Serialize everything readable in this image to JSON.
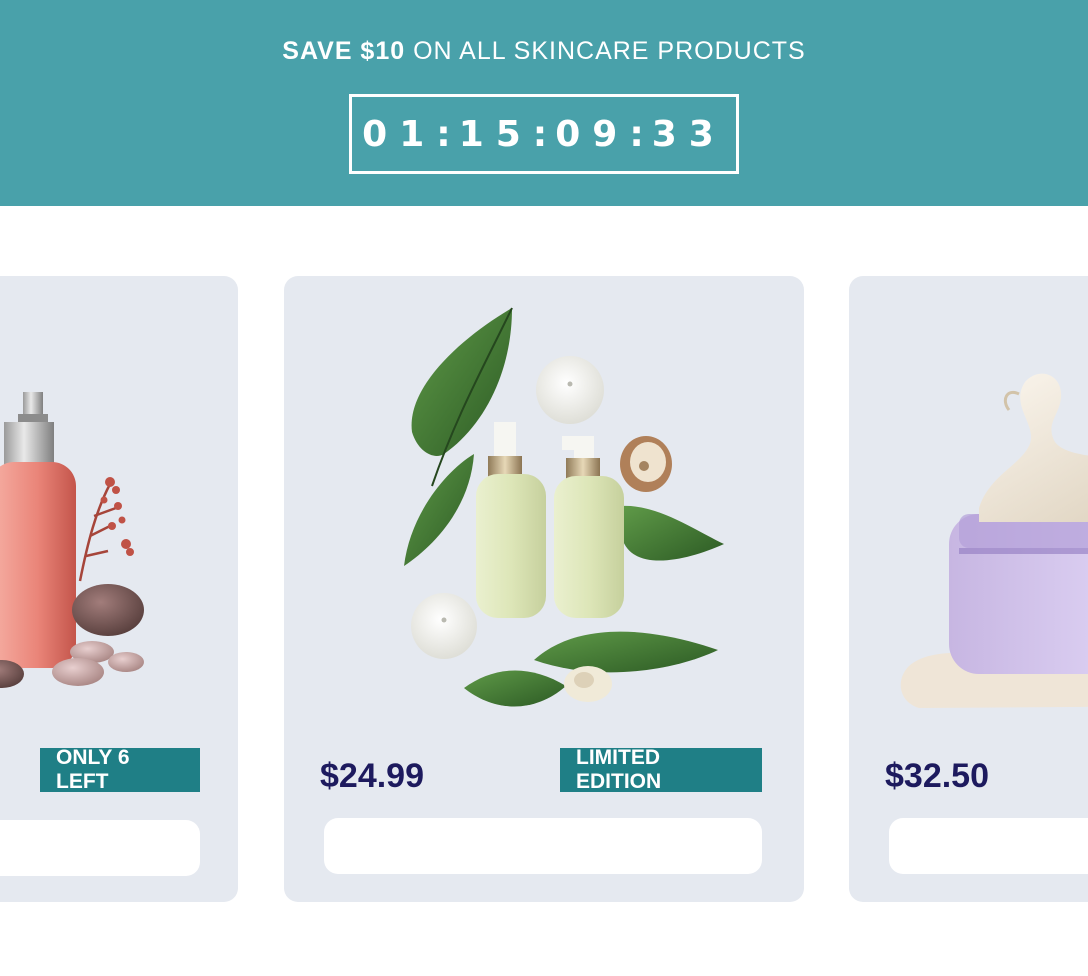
{
  "promo": {
    "bold_text": "SAVE $10",
    "rest_text": " ON ALL SKINCARE PRODUCTS"
  },
  "countdown": [
    "01",
    "15",
    "09",
    "33"
  ],
  "products": [
    {
      "id": "left",
      "price": "",
      "badge": "ONLY 6 LEFT",
      "image": "pink-spray-bottle-with-stones"
    },
    {
      "id": "center",
      "price": "$24.99",
      "badge": "LIMITED EDITION",
      "image": "serum-bottles-with-leaves"
    },
    {
      "id": "right",
      "price": "$32.50",
      "badge": "",
      "image": "lavender-cream-jar"
    }
  ],
  "colors": {
    "banner": "#49a1aa",
    "badge": "#1f7f86",
    "price": "#1d1a5e",
    "card": "#e5e9f0"
  }
}
